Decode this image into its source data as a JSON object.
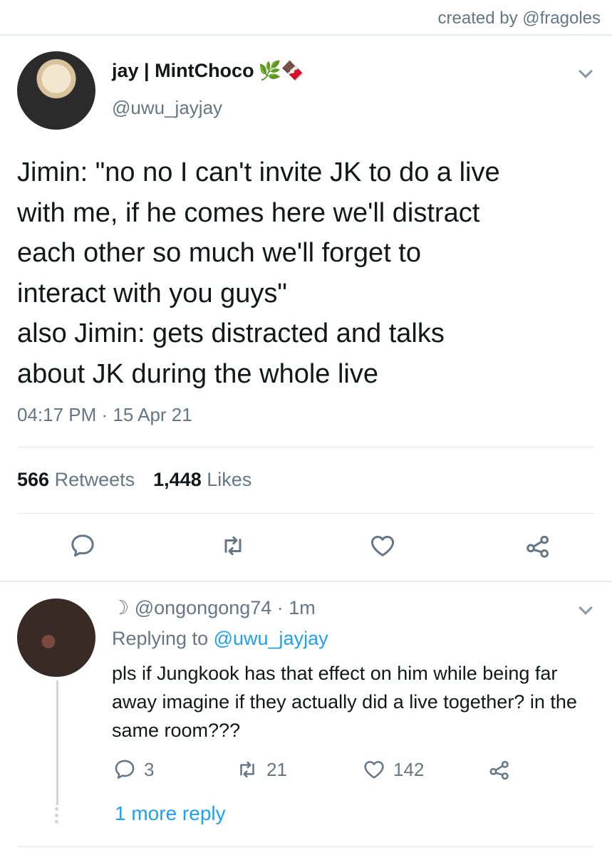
{
  "credit": "created by @fragoles",
  "tweet": {
    "display_name": "jay | MintChoco",
    "name_emoji": "🌿🍫",
    "handle": "@uwu_jayjay",
    "text": "Jimin: \"no no I can't invite JK to do a live\nwith me, if he comes here we'll distract\neach other so much we'll forget to\ninteract with you guys\"\nalso Jimin: gets distracted and talks\nabout JK during the whole live",
    "timestamp": "04:17 PM · 15 Apr 21",
    "retweet_count": "566",
    "retweet_label": "Retweets",
    "like_count": "1,448",
    "like_label": "Likes",
    "actions": [
      "reply-icon",
      "retweet-icon",
      "like-icon",
      "share-icon"
    ]
  },
  "reply": {
    "head": "☽ @ongongong74 · 1m",
    "replying_prefix": "Replying to ",
    "replying_to": "@uwu_jayjay",
    "text": "pls if Jungkook has that  effect on him while being far away imagine if they actually did a live together? in the same room???",
    "reply_count": "3",
    "retweet_count": "21",
    "like_count": "142",
    "more_replies": "1 more reply"
  },
  "colors": {
    "accent": "#1da1f2",
    "secondary_text": "#657786",
    "icon": "#657786",
    "divider": "#e1e8ed"
  }
}
